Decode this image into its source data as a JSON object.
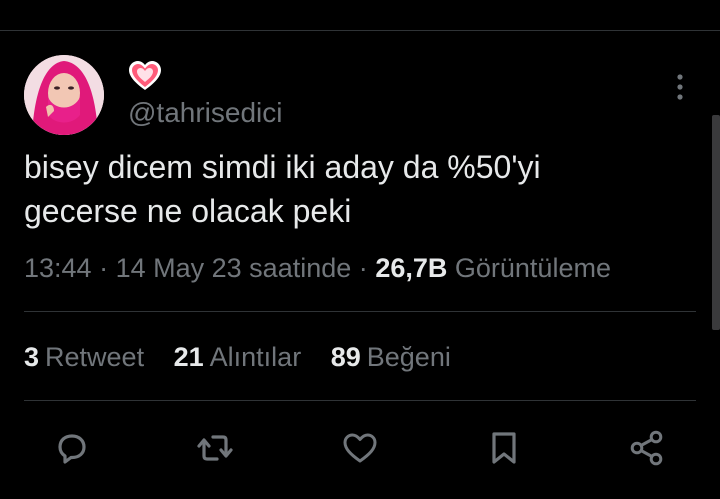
{
  "tweet": {
    "handle": "@tahrisedici",
    "text_lines": [
      "bisey dicem simdi iki aday da %50'yi",
      "gecerse ne olacak peki"
    ],
    "time": "13:44",
    "date": "14 May 23 saatinde",
    "views_count": "26,7B",
    "views_label": "Görüntüleme",
    "separator": "·"
  },
  "stats": [
    {
      "count": "3",
      "label": "Retweet"
    },
    {
      "count": "21",
      "label": "Alıntılar"
    },
    {
      "count": "89",
      "label": "Beğeni"
    }
  ],
  "icons": {
    "name_emoji": "heart-emoji-icon",
    "more": "more-vertical-icon",
    "reply": "reply-icon",
    "retweet": "retweet-icon",
    "like": "like-heart-icon",
    "bookmark": "bookmark-icon",
    "share": "share-icon"
  },
  "colors": {
    "background": "#000000",
    "text_primary": "#e7e9ea",
    "text_secondary": "#71767b",
    "divider": "#2f3336",
    "emoji_heart": "#ff5c7a"
  }
}
